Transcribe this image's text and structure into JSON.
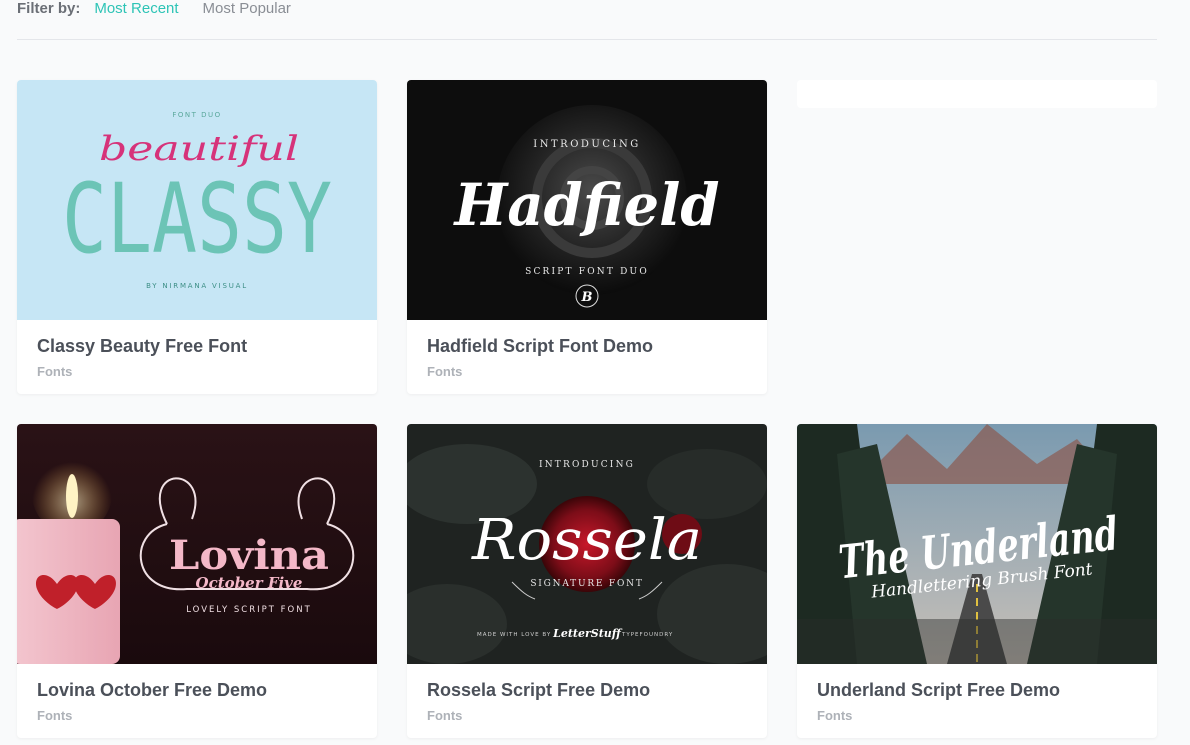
{
  "filter": {
    "label": "Filter by:",
    "options": [
      "Most Recent",
      "Most Popular"
    ],
    "active": "Most Recent"
  },
  "cards": [
    {
      "title": "Classy Beauty Free Font",
      "category": "Fonts",
      "art": {
        "top": "FONT DUO",
        "script": "beautiful",
        "main": "CLASSY",
        "bottom": "BY NIRMANA VISUAL"
      }
    },
    {
      "title": "Hadfield Script Font Demo",
      "category": "Fonts",
      "art": {
        "top": "INTRODUCING",
        "script": "Hadfield",
        "bottom": "SCRIPT FONT DUO",
        "badge": "B"
      }
    },
    {
      "title": "Lovina October Free Demo",
      "category": "Fonts",
      "art": {
        "script": "Lovina",
        "sub": "October Five",
        "bottom": "LOVELY SCRIPT FONT"
      }
    },
    {
      "title": "Rossela Script Free Demo",
      "category": "Fonts",
      "art": {
        "top": "INTRODUCING",
        "script": "Rossela",
        "sub": "SIGNATURE FONT",
        "foot_left": "MADE WITH LOVE BY",
        "foot_mid": "LetterStuff",
        "foot_right": "TYPEFOUNDRY"
      }
    },
    {
      "title": "Underland Script Free Demo",
      "category": "Fonts",
      "art": {
        "script": "The Underland",
        "sub": "Handlettering Brush Font"
      }
    }
  ],
  "colors": {
    "accent": "#2ec4b6",
    "classy_bg": "#c6e6f5",
    "classy_text": "#6cc4b6",
    "classy_script": "#d6337a"
  }
}
